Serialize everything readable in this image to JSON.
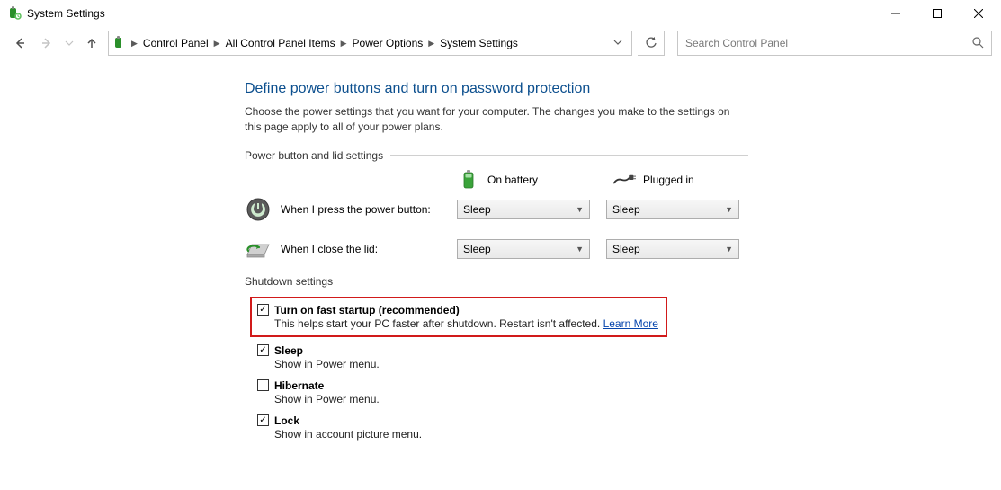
{
  "window": {
    "title": "System Settings"
  },
  "breadcrumb": {
    "items": [
      "Control Panel",
      "All Control Panel Items",
      "Power Options",
      "System Settings"
    ]
  },
  "search": {
    "placeholder": "Search Control Panel"
  },
  "page": {
    "title": "Define power buttons and turn on password protection",
    "description": "Choose the power settings that you want for your computer. The changes you make to the settings on this page apply to all of your power plans."
  },
  "section_power": {
    "header": "Power button and lid settings",
    "col_battery": "On battery",
    "col_plugged": "Plugged in",
    "rows": [
      {
        "label": "When I press the power button:",
        "battery": "Sleep",
        "plugged": "Sleep"
      },
      {
        "label": "When I close the lid:",
        "battery": "Sleep",
        "plugged": "Sleep"
      }
    ]
  },
  "section_shutdown": {
    "header": "Shutdown settings",
    "items": [
      {
        "label": "Turn on fast startup (recommended)",
        "checked": true,
        "desc": "This helps start your PC faster after shutdown. Restart isn't affected.",
        "link": "Learn More",
        "highlight": true
      },
      {
        "label": "Sleep",
        "checked": true,
        "desc": "Show in Power menu."
      },
      {
        "label": "Hibernate",
        "checked": false,
        "desc": "Show in Power menu."
      },
      {
        "label": "Lock",
        "checked": true,
        "desc": "Show in account picture menu."
      }
    ]
  }
}
